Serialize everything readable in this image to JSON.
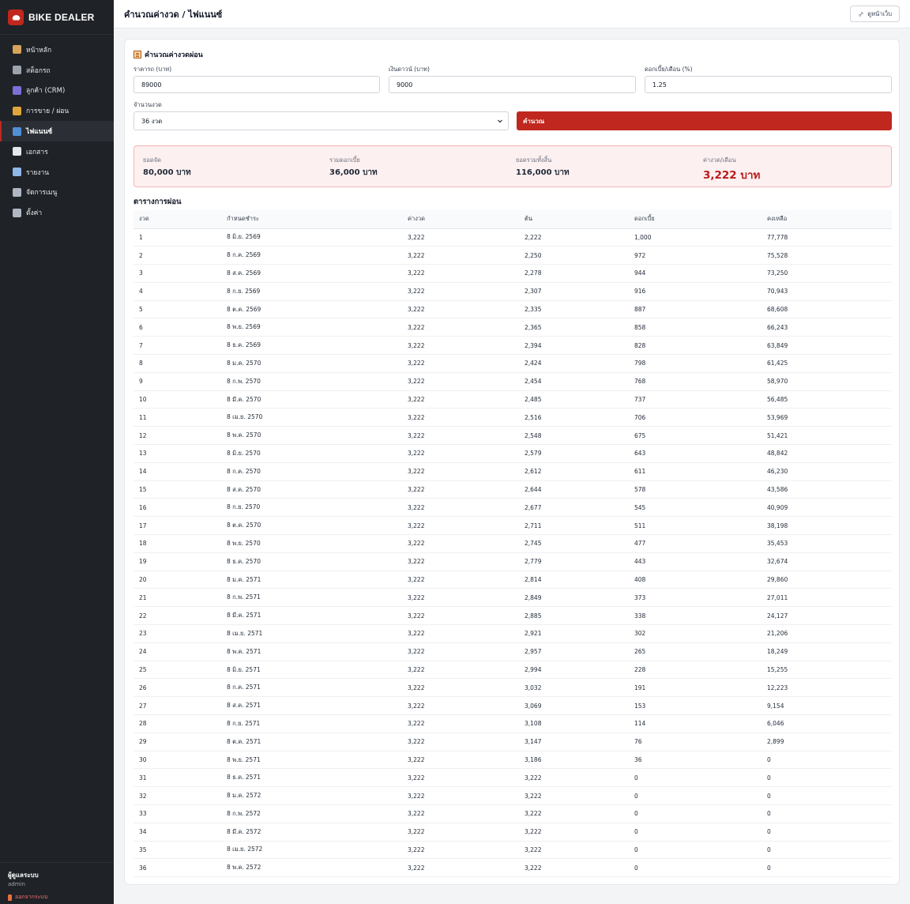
{
  "brand": {
    "name": "BIKE DEALER",
    "accent": "#c0271e"
  },
  "sidebar": {
    "items": [
      {
        "label": "หน้าหลัก",
        "icon": "home-icon",
        "active": false
      },
      {
        "label": "สต็อกรถ",
        "icon": "motorcycle-icon",
        "active": false
      },
      {
        "label": "ลูกค้า (CRM)",
        "icon": "users-icon",
        "active": false
      },
      {
        "label": "การขาย / ผ่อน",
        "icon": "money-bag-icon",
        "active": false
      },
      {
        "label": "ไฟแนนซ์",
        "icon": "bar-chart-icon",
        "active": true
      },
      {
        "label": "เอกสาร",
        "icon": "document-icon",
        "active": false
      },
      {
        "label": "รายงาน",
        "icon": "line-chart-icon",
        "active": false
      },
      {
        "label": "จัดการเมนู",
        "icon": "link-icon",
        "active": false
      },
      {
        "label": "ตั้งค่า",
        "icon": "gear-icon",
        "active": false
      }
    ],
    "user": {
      "role": "ผู้ดูแลระบบ",
      "name": "admin",
      "logout_label": "ออกจากระบบ"
    }
  },
  "header": {
    "title": "คำนวณค่างวด / ไฟแนนซ์",
    "view_web_label": "ดูหน้าเว็บ"
  },
  "calculator": {
    "title": "คำนวณค่างวดผ่อน",
    "price_label": "ราคารถ (บาท)",
    "price_value": "89000",
    "down_label": "เงินดาวน์ (บาท)",
    "down_value": "9000",
    "rate_label": "ดอกเบี้ย/เดือน (%)",
    "rate_value": "1.25",
    "term_label": "จำนวนงวด",
    "term_value": "36 งวด",
    "submit_label": "คำนวณ"
  },
  "summary": {
    "financed_label": "ยอดจัด",
    "financed_value": "80,000 บาท",
    "interest_label": "รวมดอกเบี้ย",
    "interest_value": "36,000 บาท",
    "total_label": "ยอดรวมทั้งสิ้น",
    "total_value": "116,000 บาท",
    "monthly_label": "ค่างวด/เดือน",
    "monthly_value": "3,222 บาท"
  },
  "schedule": {
    "title": "ตารางการผ่อน",
    "columns": [
      "งวด",
      "กำหนดชำระ",
      "ค่างวด",
      "ต้น",
      "ดอกเบี้ย",
      "คงเหลือ"
    ],
    "rows": [
      [
        "1",
        "8 มิ.ย. 2569",
        "3,222",
        "2,222",
        "1,000",
        "77,778"
      ],
      [
        "2",
        "8 ก.ค. 2569",
        "3,222",
        "2,250",
        "972",
        "75,528"
      ],
      [
        "3",
        "8 ส.ค. 2569",
        "3,222",
        "2,278",
        "944",
        "73,250"
      ],
      [
        "4",
        "8 ก.ย. 2569",
        "3,222",
        "2,307",
        "916",
        "70,943"
      ],
      [
        "5",
        "8 ต.ค. 2569",
        "3,222",
        "2,335",
        "887",
        "68,608"
      ],
      [
        "6",
        "8 พ.ย. 2569",
        "3,222",
        "2,365",
        "858",
        "66,243"
      ],
      [
        "7",
        "8 ธ.ค. 2569",
        "3,222",
        "2,394",
        "828",
        "63,849"
      ],
      [
        "8",
        "8 ม.ค. 2570",
        "3,222",
        "2,424",
        "798",
        "61,425"
      ],
      [
        "9",
        "8 ก.พ. 2570",
        "3,222",
        "2,454",
        "768",
        "58,970"
      ],
      [
        "10",
        "8 มี.ค. 2570",
        "3,222",
        "2,485",
        "737",
        "56,485"
      ],
      [
        "11",
        "8 เม.ย. 2570",
        "3,222",
        "2,516",
        "706",
        "53,969"
      ],
      [
        "12",
        "8 พ.ค. 2570",
        "3,222",
        "2,548",
        "675",
        "51,421"
      ],
      [
        "13",
        "8 มิ.ย. 2570",
        "3,222",
        "2,579",
        "643",
        "48,842"
      ],
      [
        "14",
        "8 ก.ค. 2570",
        "3,222",
        "2,612",
        "611",
        "46,230"
      ],
      [
        "15",
        "8 ส.ค. 2570",
        "3,222",
        "2,644",
        "578",
        "43,586"
      ],
      [
        "16",
        "8 ก.ย. 2570",
        "3,222",
        "2,677",
        "545",
        "40,909"
      ],
      [
        "17",
        "8 ต.ค. 2570",
        "3,222",
        "2,711",
        "511",
        "38,198"
      ],
      [
        "18",
        "8 พ.ย. 2570",
        "3,222",
        "2,745",
        "477",
        "35,453"
      ],
      [
        "19",
        "8 ธ.ค. 2570",
        "3,222",
        "2,779",
        "443",
        "32,674"
      ],
      [
        "20",
        "8 ม.ค. 2571",
        "3,222",
        "2,814",
        "408",
        "29,860"
      ],
      [
        "21",
        "8 ก.พ. 2571",
        "3,222",
        "2,849",
        "373",
        "27,011"
      ],
      [
        "22",
        "8 มี.ค. 2571",
        "3,222",
        "2,885",
        "338",
        "24,127"
      ],
      [
        "23",
        "8 เม.ย. 2571",
        "3,222",
        "2,921",
        "302",
        "21,206"
      ],
      [
        "24",
        "8 พ.ค. 2571",
        "3,222",
        "2,957",
        "265",
        "18,249"
      ],
      [
        "25",
        "8 มิ.ย. 2571",
        "3,222",
        "2,994",
        "228",
        "15,255"
      ],
      [
        "26",
        "8 ก.ค. 2571",
        "3,222",
        "3,032",
        "191",
        "12,223"
      ],
      [
        "27",
        "8 ส.ค. 2571",
        "3,222",
        "3,069",
        "153",
        "9,154"
      ],
      [
        "28",
        "8 ก.ย. 2571",
        "3,222",
        "3,108",
        "114",
        "6,046"
      ],
      [
        "29",
        "8 ต.ค. 2571",
        "3,222",
        "3,147",
        "76",
        "2,899"
      ],
      [
        "30",
        "8 พ.ย. 2571",
        "3,222",
        "3,186",
        "36",
        "0"
      ],
      [
        "31",
        "8 ธ.ค. 2571",
        "3,222",
        "3,222",
        "0",
        "0"
      ],
      [
        "32",
        "8 ม.ค. 2572",
        "3,222",
        "3,222",
        "0",
        "0"
      ],
      [
        "33",
        "8 ก.พ. 2572",
        "3,222",
        "3,222",
        "0",
        "0"
      ],
      [
        "34",
        "8 มี.ค. 2572",
        "3,222",
        "3,222",
        "0",
        "0"
      ],
      [
        "35",
        "8 เม.ย. 2572",
        "3,222",
        "3,222",
        "0",
        "0"
      ],
      [
        "36",
        "8 พ.ค. 2572",
        "3,222",
        "3,222",
        "0",
        "0"
      ]
    ]
  }
}
